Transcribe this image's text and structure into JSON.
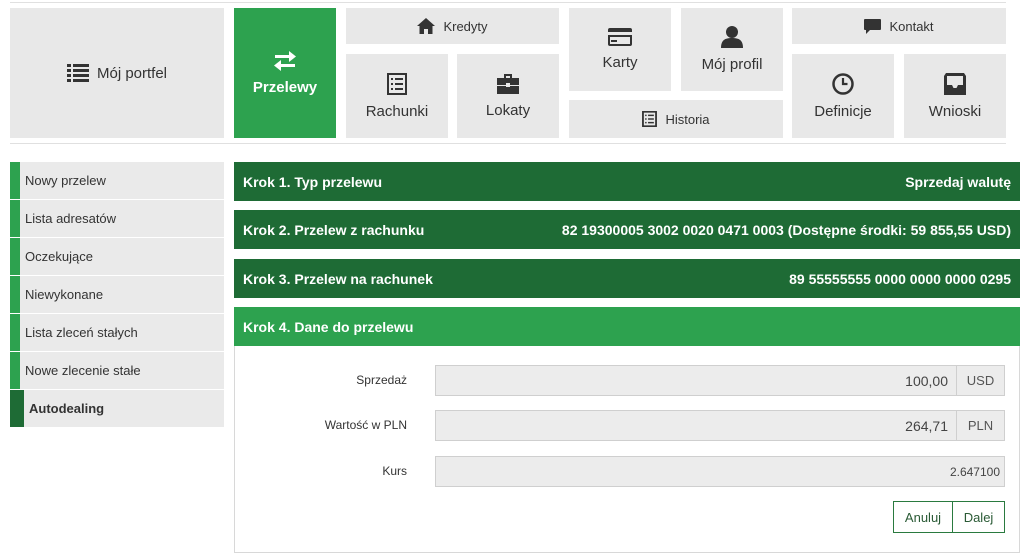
{
  "nav": {
    "portfolio": "Mój portfel",
    "transfers": "Przelewy",
    "credits": "Kredyty",
    "accounts": "Rachunki",
    "deposits": "Lokaty",
    "cards": "Karty",
    "profile": "Mój profil",
    "history": "Historia",
    "contact": "Kontakt",
    "definitions": "Definicje",
    "requests": "Wnioski"
  },
  "sidebar": {
    "items": [
      {
        "label": "Nowy przelew"
      },
      {
        "label": "Lista adresatów"
      },
      {
        "label": "Oczekujące"
      },
      {
        "label": "Niewykonane"
      },
      {
        "label": "Lista zleceń stałych"
      },
      {
        "label": "Nowe zlecenie stałe"
      },
      {
        "label": "Autodealing"
      }
    ]
  },
  "steps": [
    {
      "title": "Krok 1. Typ przelewu",
      "value": "Sprzedaj walutę"
    },
    {
      "title": "Krok 2. Przelew z rachunku",
      "value": "82 19300005 3002 0020 0471 0003 (Dostępne środki: 59 855,55 USD)"
    },
    {
      "title": "Krok 3. Przelew na rachunek",
      "value": "89 55555555 0000 0000 0000 0295"
    },
    {
      "title": "Krok 4. Dane do przelewu",
      "value": ""
    }
  ],
  "form": {
    "sale": {
      "label": "Sprzedaż",
      "value": "100,00",
      "unit": "USD"
    },
    "pln_value": {
      "label": "Wartość w PLN",
      "value": "264,71",
      "unit": "PLN"
    },
    "rate": {
      "label": "Kurs",
      "value": "2.647100"
    }
  },
  "buttons": {
    "cancel": "Anuluj",
    "next": "Dalej"
  },
  "colors": {
    "accent": "#2da24f",
    "dark": "#1e6b35",
    "tile": "#e8e8e8"
  }
}
